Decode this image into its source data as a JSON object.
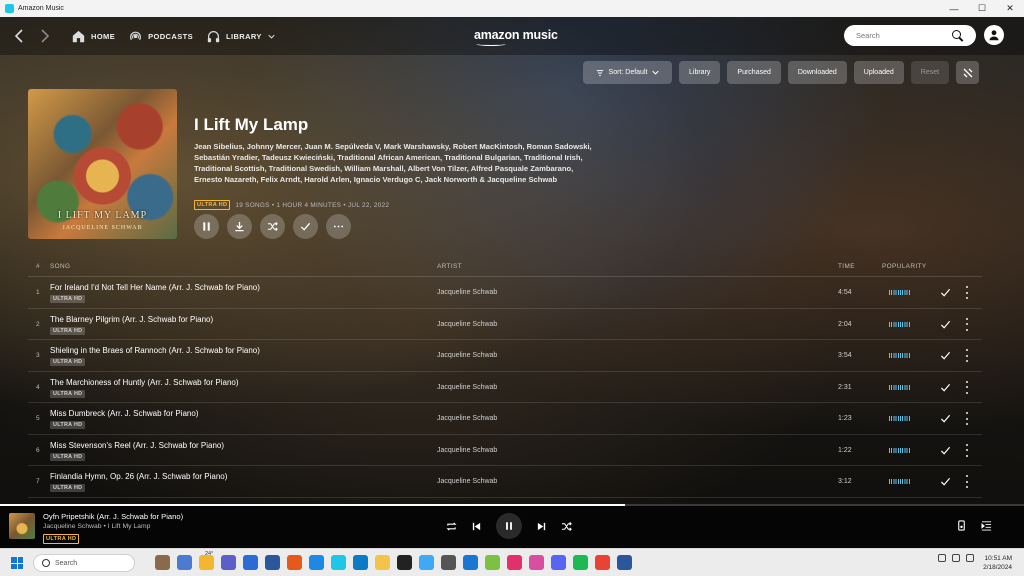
{
  "window": {
    "title": "Amazon Music",
    "minimize": "—",
    "maximize": "☐",
    "close": "✕"
  },
  "nav": {
    "home": "HOME",
    "podcasts": "PODCASTS",
    "library": "LIBRARY",
    "brand": "amazon music",
    "search_placeholder": "Search"
  },
  "filters": {
    "sort": "Sort: Default",
    "library": "Library",
    "purchased": "Purchased",
    "downloaded": "Downloaded",
    "uploaded": "Uploaded",
    "reset": "Reset"
  },
  "album": {
    "cover_text": "I LIFT MY LAMP",
    "cover_sub": "JACQUELINE SCHWAB",
    "title": "I Lift My Lamp",
    "artists": "Jean Sibelius, Johnny Mercer, Juan M. Sepúlveda V, Mark Warshawsky, Robert MacKintosh, Roman Sadowski, Sebastián Yradier, Tadeusz Kwieciński, Traditional African American, Traditional Bulgarian, Traditional Irish, Traditional Scottish, Traditional Swedish, William Marshall, Albert Von Tilzer, Alfred Pasquale Zambarano, Ernesto Nazareth, Felix Arndt, Harold Arlen, Ignacio Verdugo C, Jack Norworth & Jacqueline Schwab",
    "badge": "ULTRA HD",
    "meta": "19 SONGS • 1 HOUR 4 MINUTES • JUL 22, 2022"
  },
  "table": {
    "headers": {
      "num": "#",
      "song": "SONG",
      "artist": "ARTIST",
      "time": "TIME",
      "popularity": "POPULARITY"
    },
    "rows": [
      {
        "num": "1",
        "song": "For Ireland I'd Not Tell Her Name (Arr. J. Schwab for Piano)",
        "badge": "ULTRA HD",
        "artist": "Jacqueline Schwab",
        "time": "4:54"
      },
      {
        "num": "2",
        "song": "The Blarney Pilgrim (Arr. J. Schwab for Piano)",
        "badge": "ULTRA HD",
        "artist": "Jacqueline Schwab",
        "time": "2:04"
      },
      {
        "num": "3",
        "song": "Shieling in the Braes of Rannoch (Arr. J. Schwab for Piano)",
        "badge": "ULTRA HD",
        "artist": "Jacqueline Schwab",
        "time": "3:54"
      },
      {
        "num": "4",
        "song": "The Marchioness of Huntly (Arr. J. Schwab for Piano)",
        "badge": "ULTRA HD",
        "artist": "Jacqueline Schwab",
        "time": "2:31"
      },
      {
        "num": "5",
        "song": "Miss Dumbreck (Arr. J. Schwab for Piano)",
        "badge": "ULTRA HD",
        "artist": "Jacqueline Schwab",
        "time": "1:23"
      },
      {
        "num": "6",
        "song": "Miss Stevenson's Reel (Arr. J. Schwab for Piano)",
        "badge": "ULTRA HD",
        "artist": "Jacqueline Schwab",
        "time": "1:22"
      },
      {
        "num": "7",
        "song": "Finlandia Hymn, Op. 26 (Arr. J. Schwab for Piano)",
        "badge": "ULTRA HD",
        "artist": "Jacqueline Schwab",
        "time": "3:12"
      }
    ]
  },
  "player": {
    "title": "Oyfn Pripetshik (Arr. J. Schwab for Piano)",
    "subtitle": "Jacqueline Schwab • I Lift My Lamp",
    "badge": "ULTRA HD",
    "progress": 0.61
  },
  "taskbar": {
    "search_placeholder": "Search",
    "weather": "24°",
    "time": "10:51 AM",
    "date": "2/18/2024"
  },
  "colors": {
    "accent_uhd": "#f4b93a",
    "popularity": "#5ec5e8",
    "player_bg": "#050505"
  }
}
